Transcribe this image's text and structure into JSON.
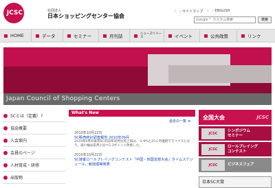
{
  "header": {
    "logo_text": "JCSC",
    "org_small": "社団法人",
    "org_name": "日本ショッピングセンター協会",
    "sitemap": "サイトマップ",
    "english": "ENGLISH",
    "search_placeholder": "Google™ カスタム検索",
    "search_button": "検索"
  },
  "nav": [
    {
      "label": "HOME"
    },
    {
      "label": "データ"
    },
    {
      "label": "セミナー"
    },
    {
      "label": "月刊誌"
    },
    {
      "label": "ニュースリリース"
    },
    {
      "label": "イベント"
    },
    {
      "label": "公共政策"
    },
    {
      "label": "リンク"
    }
  ],
  "hero": {
    "caption": "Japan Council of Shopping Centers"
  },
  "sidebar": [
    {
      "label": "SCとは（定義）?"
    },
    {
      "label": "協会概要"
    },
    {
      "label": "入会案内"
    },
    {
      "label": "会員のページ"
    },
    {
      "label": "人材育成・研修"
    },
    {
      "label": "出版物"
    }
  ],
  "news": {
    "header": "What's New",
    "more": "過去の一覧 ≫",
    "items": [
      {
        "date": "2010年10月22日",
        "title": "SC販売統計調査報告 2010年09月",
        "text": "2010年9月の既存SCの前年同月比売上高は、-2.9%と25ヶ月連続でマイナスとなり、減少幅は前月に比べ1.3ポイント改善した。"
      },
      {
        "date": "2010年10月22日",
        "title": "SC接客ロールプレイングコンテスト「中国・四国支部大会」タイムスケジュール、競技順等発表",
        "text": ""
      }
    ]
  },
  "right": {
    "zenkoku": "全国大会",
    "banners": [
      {
        "mini": "JCSC",
        "text": "シンポジウム\nセミナー"
      },
      {
        "mini": "JCSC",
        "text": "ロールプレイング\nコンテスト"
      },
      {
        "mini": "JCSC",
        "text": "ビジネスフェア"
      }
    ],
    "bottom": "日本SC大賞"
  }
}
